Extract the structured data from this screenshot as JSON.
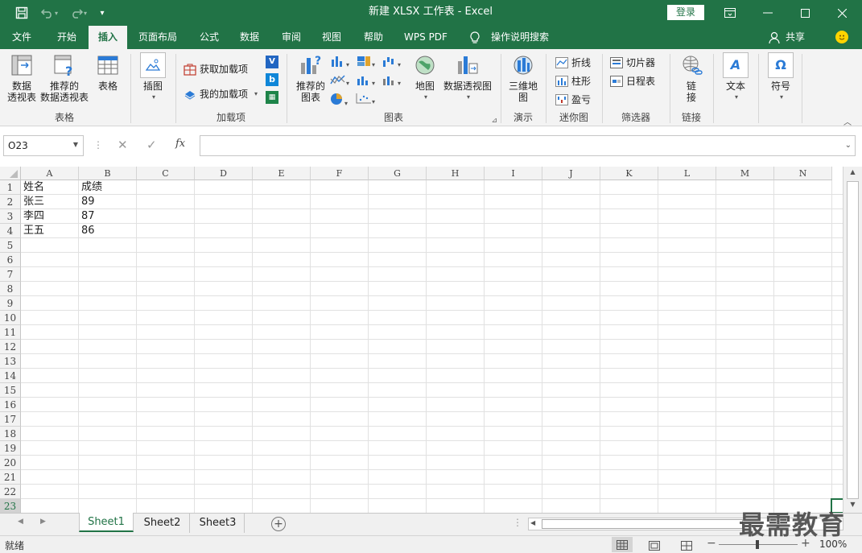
{
  "title": "新建 XLSX 工作表  -  Excel",
  "login_label": "登录",
  "tabs": [
    "文件",
    "开始",
    "插入",
    "页面布局",
    "公式",
    "数据",
    "审阅",
    "视图",
    "帮助",
    "WPS PDF"
  ],
  "search_label": "操作说明搜索",
  "share_label": "共享",
  "ribbon": {
    "tables": {
      "pivot": "数据\n透视表",
      "recommended_pivot": "推荐的\n数据透视表",
      "table": "表格",
      "group": "表格"
    },
    "illustrations": {
      "label": "插图"
    },
    "addins": {
      "get": "获取加载项",
      "my": "我的加载项",
      "group": "加载项"
    },
    "charts": {
      "recommended": "推荐的\n图表",
      "map": "地图",
      "pivot_chart": "数据透视图",
      "group": "图表"
    },
    "tours": {
      "map3d": "三维地\n图",
      "group": "演示"
    },
    "sparklines": {
      "line": "折线",
      "column": "柱形",
      "winloss": "盈亏",
      "group": "迷你图"
    },
    "filters": {
      "slicer": "切片器",
      "timeline": "日程表",
      "group": "筛选器"
    },
    "links": {
      "link": "链\n接",
      "group": "链接"
    },
    "text": {
      "label": "文本"
    },
    "symbols": {
      "label": "符号"
    }
  },
  "namebox": "O23",
  "fx_label": "fx",
  "columns": [
    "A",
    "B",
    "C",
    "D",
    "E",
    "F",
    "G",
    "H",
    "I",
    "J",
    "K",
    "L",
    "M",
    "N"
  ],
  "rows": [
    "1",
    "2",
    "3",
    "4",
    "5",
    "6",
    "7",
    "8",
    "9",
    "10",
    "11",
    "12",
    "13",
    "14",
    "15",
    "16",
    "17",
    "18",
    "19",
    "20",
    "21",
    "22",
    "23"
  ],
  "cells": {
    "A1": "姓名",
    "B1": "成绩",
    "A2": "张三",
    "B2": "89",
    "A3": "李四",
    "B3": "87",
    "A4": "王五",
    "B4": "86"
  },
  "sheets": [
    "Sheet1",
    "Sheet2",
    "Sheet3"
  ],
  "status": "就绪",
  "zoom": "100%",
  "watermark": "最需教育"
}
